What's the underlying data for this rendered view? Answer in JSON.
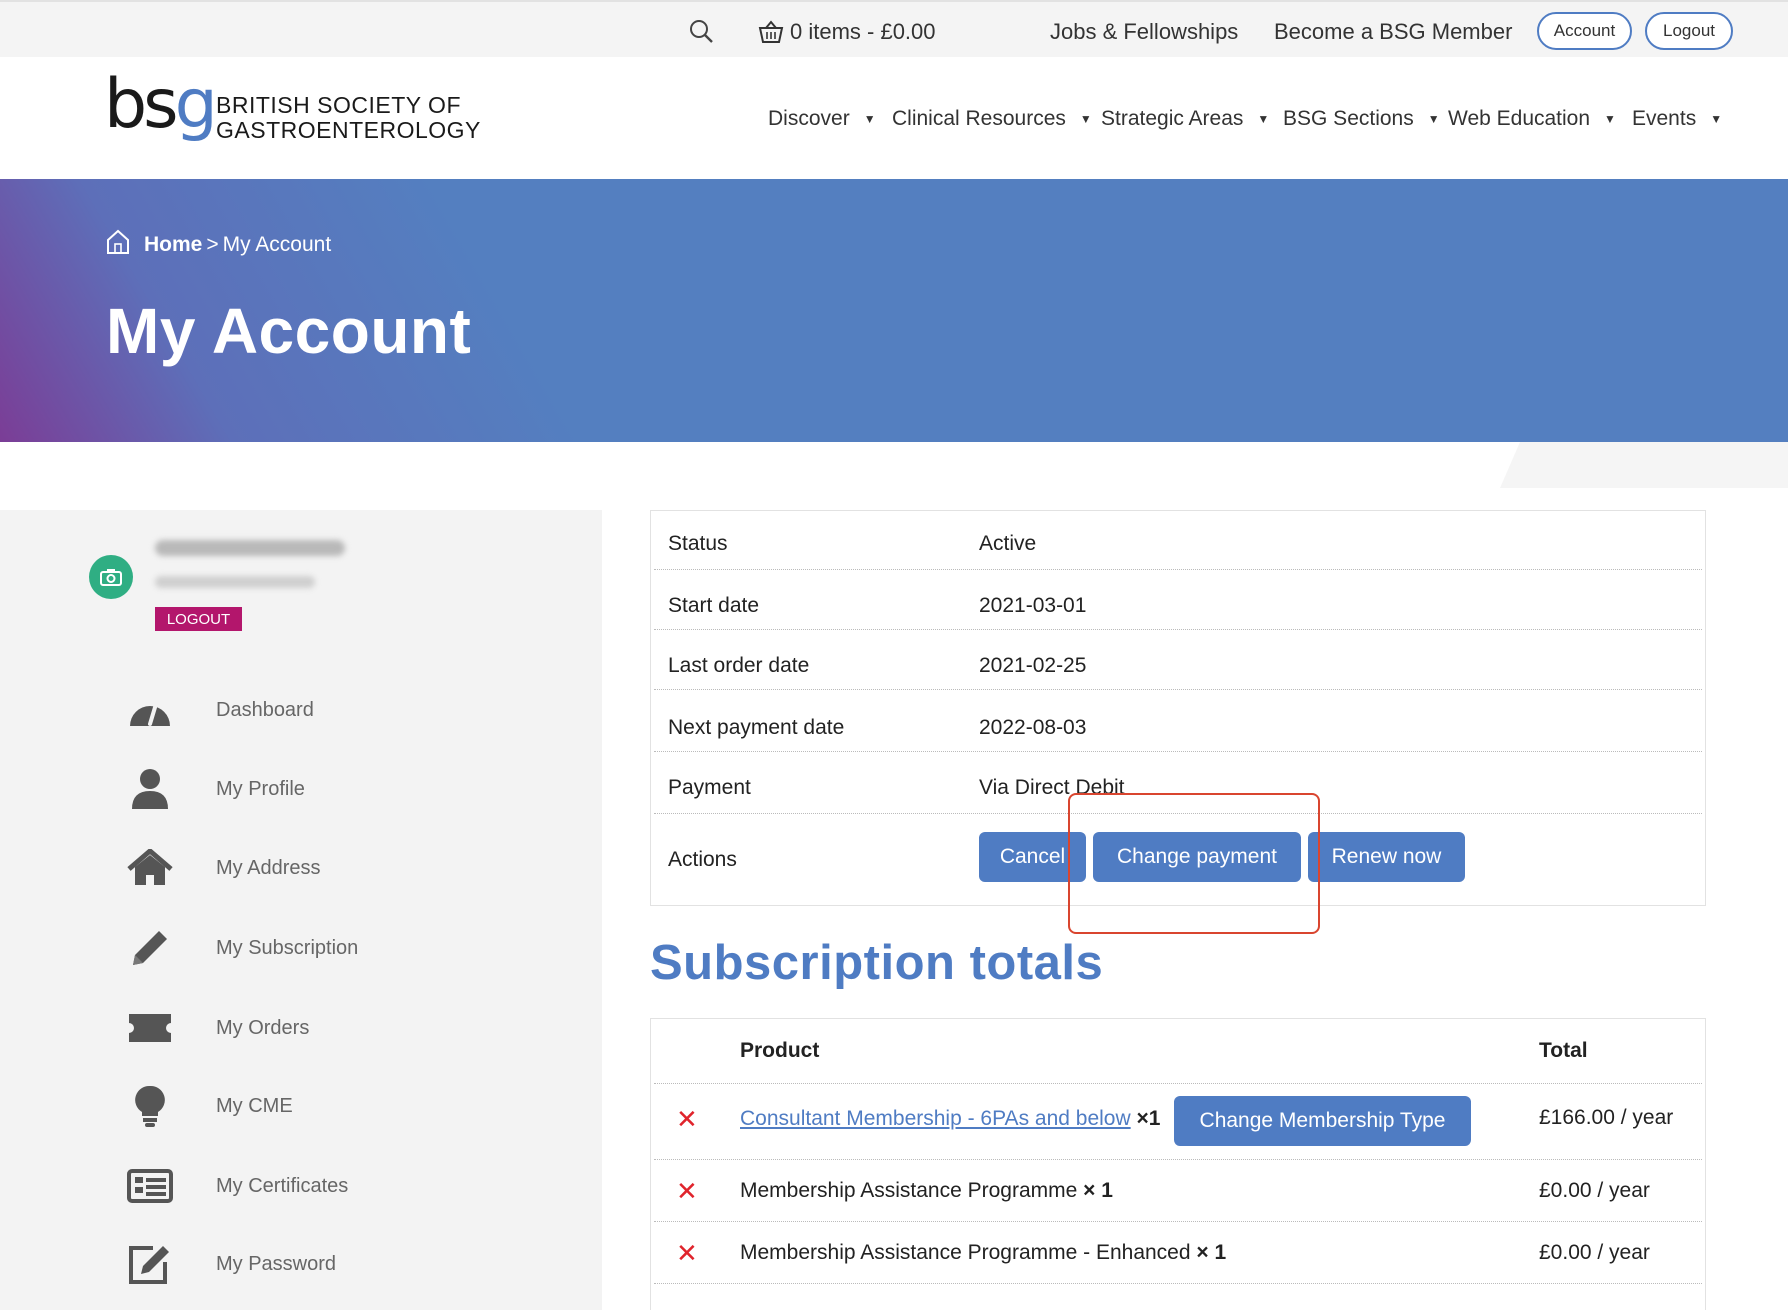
{
  "topbar": {
    "cart": "0 items - £0.00",
    "jobs": "Jobs & Fellowships",
    "become_member": "Become a BSG Member",
    "account": "Account",
    "logout": "Logout"
  },
  "header": {
    "logo_mark": "bsg",
    "logo_line1": "BRITISH SOCIETY OF",
    "logo_line2": "GASTROENTEROLOGY",
    "nav": [
      "Discover",
      "Clinical Resources",
      "Strategic Areas",
      "BSG Sections",
      "Web Education",
      "Events"
    ]
  },
  "hero": {
    "breadcrumb_home": "Home",
    "breadcrumb_sep": ">",
    "breadcrumb_current": "My Account",
    "title": "My Account"
  },
  "sidebar": {
    "logout_label": "LOGOUT",
    "items": [
      {
        "label": "Dashboard",
        "icon": "dashboard-icon"
      },
      {
        "label": "My Profile",
        "icon": "user-icon"
      },
      {
        "label": "My Address",
        "icon": "home-icon"
      },
      {
        "label": "My Subscription",
        "icon": "pencil-icon"
      },
      {
        "label": "My Orders",
        "icon": "ticket-icon"
      },
      {
        "label": "My CME",
        "icon": "lightbulb-icon"
      },
      {
        "label": "My Certificates",
        "icon": "certificate-icon"
      },
      {
        "label": "My Password",
        "icon": "edit-icon"
      }
    ]
  },
  "subscription": {
    "rows": [
      {
        "label": "Status",
        "value": "Active"
      },
      {
        "label": "Start date",
        "value": "2021-03-01"
      },
      {
        "label": "Last order date",
        "value": "2021-02-25"
      },
      {
        "label": "Next payment date",
        "value": "2022-08-03"
      },
      {
        "label": "Payment",
        "value": "Via Direct Debit"
      }
    ],
    "actions_label": "Actions",
    "actions": [
      "Cancel",
      "Change payment",
      "Renew now"
    ]
  },
  "totals": {
    "title": "Subscription totals",
    "header_product": "Product",
    "header_total": "Total",
    "remove_symbol": "✕",
    "change_type_button": "Change Membership Type",
    "items": [
      {
        "product": "Consultant Membership - 6PAs and below",
        "qty_prefix": "×",
        "qty": "1",
        "total": "£166.00 / year"
      },
      {
        "product": "Membership Assistance Programme",
        "qty_prefix": "×",
        "qty": "1",
        "total": "£0.00 / year"
      },
      {
        "product": "Membership Assistance Programme - Enhanced",
        "qty_prefix": "×",
        "qty": "1",
        "total": "£0.00 / year"
      }
    ]
  },
  "colors": {
    "accent": "#4f7cc3",
    "hero": "#547fc0",
    "logout_badge": "#b3166c",
    "remove": "#e0242c",
    "highlight": "#d9452f"
  }
}
